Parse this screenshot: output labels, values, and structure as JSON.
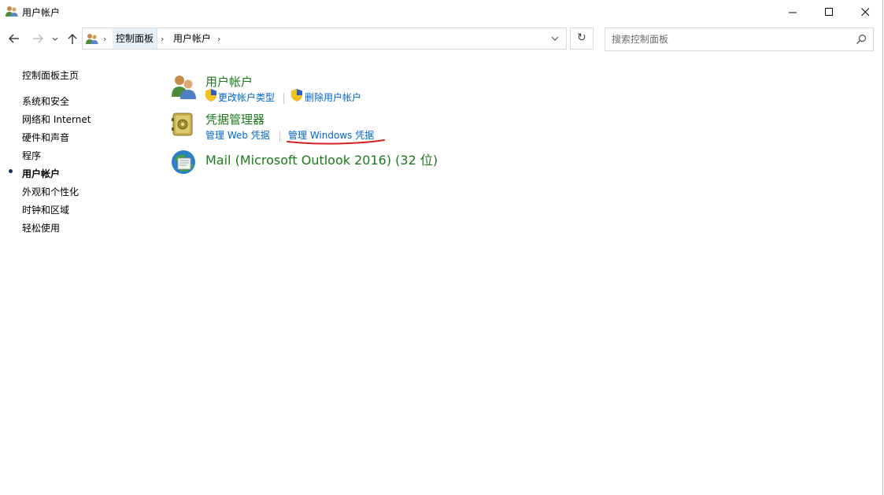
{
  "window": {
    "title": "用户帐户"
  },
  "address": {
    "crumbs": [
      "控制面板",
      "用户帐户"
    ]
  },
  "search": {
    "placeholder": "搜索控制面板",
    "value": ""
  },
  "leftnav": {
    "items": [
      {
        "label": "控制面板主页",
        "current": false
      },
      {
        "label": "系统和安全",
        "current": false
      },
      {
        "label": "网络和 Internet",
        "current": false
      },
      {
        "label": "硬件和声音",
        "current": false
      },
      {
        "label": "程序",
        "current": false
      },
      {
        "label": "用户帐户",
        "current": true
      },
      {
        "label": "外观和个性化",
        "current": false
      },
      {
        "label": "时钟和区域",
        "current": false
      },
      {
        "label": "轻松使用",
        "current": false
      }
    ]
  },
  "categories": [
    {
      "title": "用户帐户",
      "icon": "users-icon",
      "links": [
        "更改帐户类型",
        "删除用户帐户"
      ]
    },
    {
      "title": "凭据管理器",
      "icon": "credential-vault-icon",
      "links": [
        "管理 Web 凭据",
        "管理 Windows 凭据"
      ]
    },
    {
      "title": "Mail (Microsoft Outlook 2016) (32 位)",
      "icon": "mail-icon",
      "links": []
    }
  ],
  "colors": {
    "category_title": "#1b7a1b",
    "link": "#0066cc",
    "annotation_underline": "#d42020",
    "crumb_highlight": "#e5f1fb"
  }
}
